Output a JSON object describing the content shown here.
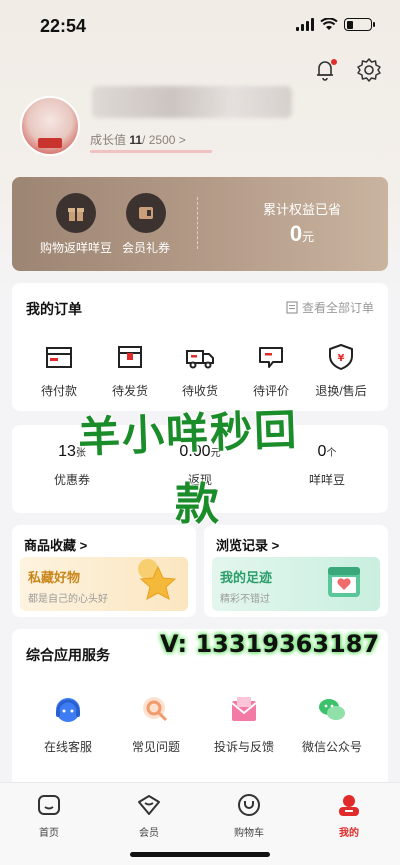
{
  "status_bar": {
    "time": "22:54"
  },
  "profile": {
    "growth_label": "成长值",
    "growth_current": "11",
    "growth_total": "/ 2500  >"
  },
  "benefits": {
    "items": [
      {
        "label": "购物返咩咩豆",
        "icon": "gift-icon"
      },
      {
        "label": "会员礼券",
        "icon": "coupon-icon"
      }
    ],
    "savings_title": "累计权益已省",
    "savings_value": "0",
    "savings_unit": "元"
  },
  "orders": {
    "title": "我的订单",
    "view_all": "查看全部订单",
    "items": [
      {
        "label": "待付款",
        "icon": "wallet-icon"
      },
      {
        "label": "待发货",
        "icon": "box-icon"
      },
      {
        "label": "待收货",
        "icon": "truck-icon"
      },
      {
        "label": "待评价",
        "icon": "comment-icon"
      },
      {
        "label": "退换/售后",
        "icon": "shield-yen-icon"
      }
    ]
  },
  "assets": [
    {
      "value": "13",
      "unit": "张",
      "label": "优惠券"
    },
    {
      "value": "0.00",
      "unit": "元",
      "label": "返现"
    },
    {
      "value": "0",
      "unit": "个",
      "label": "咩咩豆"
    }
  ],
  "favorites": {
    "title": "商品收藏 >",
    "promo_title": "私藏好物",
    "promo_sub": "都是自己的心头好"
  },
  "history": {
    "title": "浏览记录 >",
    "promo_title": "我的足迹",
    "promo_sub": "精彩不错过"
  },
  "services": {
    "title": "综合应用服务",
    "items": [
      {
        "label": "在线客服",
        "icon": "headset-icon"
      },
      {
        "label": "常见问题",
        "icon": "faq-icon"
      },
      {
        "label": "投诉与反馈",
        "icon": "mail-icon"
      },
      {
        "label": "微信公众号",
        "icon": "wechat-icon"
      }
    ]
  },
  "watermark": {
    "line1": "羊小咩秒回",
    "line2": "款",
    "phone": "V: 13319363187"
  },
  "tabbar": {
    "items": [
      {
        "label": "首页",
        "icon": "home-icon"
      },
      {
        "label": "会员",
        "icon": "member-icon"
      },
      {
        "label": "购物车",
        "icon": "cart-icon"
      },
      {
        "label": "我的",
        "icon": "profile-icon",
        "active": true
      }
    ]
  },
  "colors": {
    "accent": "#e12a2a",
    "benefit_card": "#b49c89",
    "favorites_promo": "#c9861a",
    "history_promo": "#2a9d6a"
  }
}
